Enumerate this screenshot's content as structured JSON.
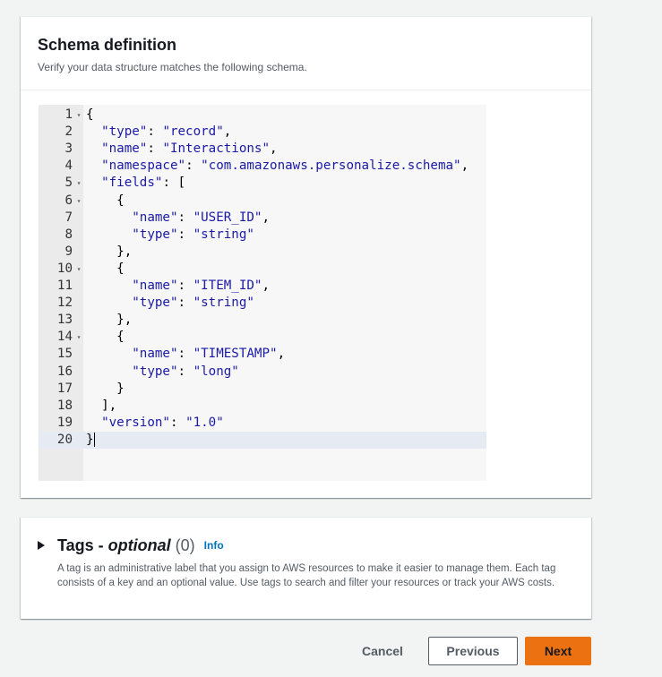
{
  "schema": {
    "title": "Schema definition",
    "description": "Verify your data structure matches the following schema.",
    "lines": [
      {
        "num": "1",
        "fold": true,
        "code": "{"
      },
      {
        "num": "2",
        "fold": false,
        "code": "  \"type\": \"record\","
      },
      {
        "num": "3",
        "fold": false,
        "code": "  \"name\": \"Interactions\","
      },
      {
        "num": "4",
        "fold": false,
        "code": "  \"namespace\": \"com.amazonaws.personalize.schema\","
      },
      {
        "num": "5",
        "fold": true,
        "code": "  \"fields\": ["
      },
      {
        "num": "6",
        "fold": true,
        "code": "    {"
      },
      {
        "num": "7",
        "fold": false,
        "code": "      \"name\": \"USER_ID\","
      },
      {
        "num": "8",
        "fold": false,
        "code": "      \"type\": \"string\""
      },
      {
        "num": "9",
        "fold": false,
        "code": "    },"
      },
      {
        "num": "10",
        "fold": true,
        "code": "    {"
      },
      {
        "num": "11",
        "fold": false,
        "code": "      \"name\": \"ITEM_ID\","
      },
      {
        "num": "12",
        "fold": false,
        "code": "      \"type\": \"string\""
      },
      {
        "num": "13",
        "fold": false,
        "code": "    },"
      },
      {
        "num": "14",
        "fold": true,
        "code": "    {"
      },
      {
        "num": "15",
        "fold": false,
        "code": "      \"name\": \"TIMESTAMP\","
      },
      {
        "num": "16",
        "fold": false,
        "code": "      \"type\": \"long\""
      },
      {
        "num": "17",
        "fold": false,
        "code": "    }"
      },
      {
        "num": "18",
        "fold": false,
        "code": "  ],"
      },
      {
        "num": "19",
        "fold": false,
        "code": "  \"version\": \"1.0\""
      },
      {
        "num": "20",
        "fold": false,
        "code": "}",
        "active": true
      }
    ]
  },
  "tags": {
    "title": "Tags - ",
    "optional": "optional",
    "count": "(0)",
    "info": "Info",
    "description": "A tag is an administrative label that you assign to AWS resources to make it easier to manage them. Each tag consists of a key and an optional value. Use tags to search and filter your resources or track your AWS costs."
  },
  "actions": {
    "cancel": "Cancel",
    "previous": "Previous",
    "next": "Next"
  },
  "colors": {
    "primary": "#ec7211",
    "link": "#0073bb",
    "code_string": "#1a1aa6"
  }
}
